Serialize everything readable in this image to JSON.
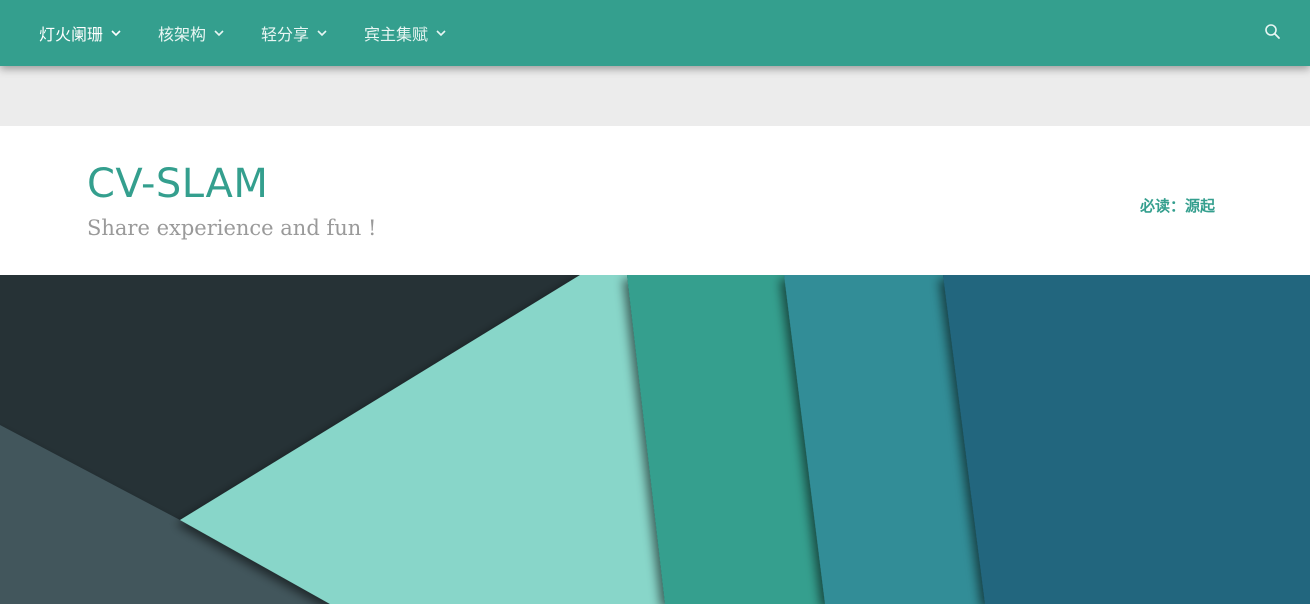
{
  "nav": {
    "items": [
      {
        "label": "灯火阑珊",
        "active": true
      },
      {
        "label": "核架构",
        "active": false
      },
      {
        "label": "轻分享",
        "active": false
      },
      {
        "label": "宾主集赋",
        "active": false
      }
    ],
    "search_icon": "search-icon"
  },
  "header": {
    "title": "CV-SLAM",
    "description": "Share experience and fun !",
    "must_read": "必读：源起"
  },
  "colors": {
    "accent": "#349f8e",
    "nav_text": "#e8f6f3",
    "description": "#9a9a9a",
    "background": "#ececec"
  }
}
